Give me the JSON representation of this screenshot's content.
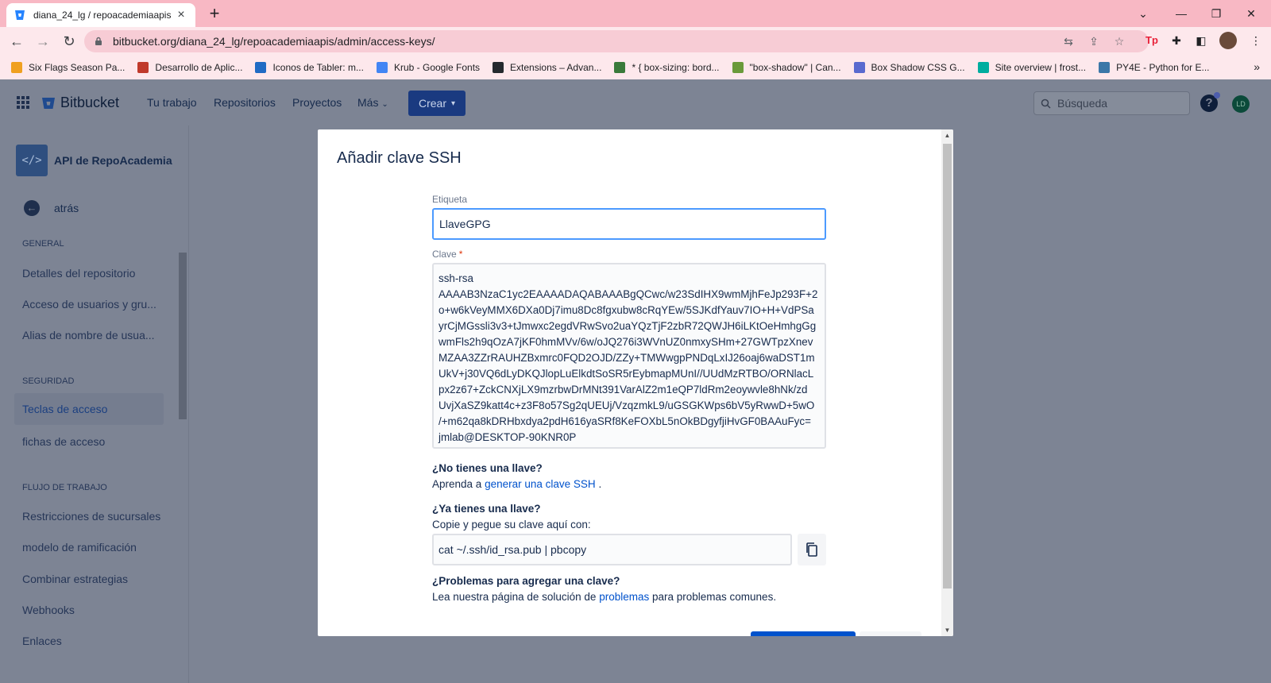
{
  "browser": {
    "tab_title": "diana_24_lg / repoacademiaapis",
    "url": "bitbucket.org/diana_24_lg/repoacademiaapis/admin/access-keys/",
    "bookmarks": [
      {
        "label": "Six Flags Season Pa...",
        "color": "#f0a020"
      },
      {
        "label": "Desarrollo de Aplic...",
        "color": "#c0392b"
      },
      {
        "label": "Iconos de Tabler: m...",
        "color": "#206bc4"
      },
      {
        "label": "Krub - Google Fonts",
        "color": "#4285f4"
      },
      {
        "label": "Extensions – Advan...",
        "color": "#24292e"
      },
      {
        "label": "* { box-sizing: bord...",
        "color": "#3a7a3a"
      },
      {
        "label": "\"box-shadow\" | Can...",
        "color": "#6a9a3a"
      },
      {
        "label": "Box Shadow CSS G...",
        "color": "#5a6acf"
      },
      {
        "label": "Site overview | frost...",
        "color": "#00ad9f"
      },
      {
        "label": "PY4E - Python for E...",
        "color": "#3b77a8"
      }
    ]
  },
  "header": {
    "product": "Bitbucket",
    "nav": [
      "Tu trabajo",
      "Repositorios",
      "Proyectos",
      "Más"
    ],
    "create": "Crear",
    "search_placeholder": "Búsqueda",
    "help": "?",
    "avatar": "LD"
  },
  "sidebar": {
    "repo_name": "API de RepoAcademia",
    "back": "atrás",
    "sections": {
      "general": "GENERAL",
      "security": "SEGURIDAD",
      "workflow": "FLUJO DE TRABAJO"
    },
    "general_items": [
      "Detalles del repositorio",
      "Acceso de usuarios y gru...",
      "Alias de nombre de usua..."
    ],
    "security_items": [
      "Teclas de acceso",
      "fichas de acceso"
    ],
    "workflow_items": [
      "Restricciones de sucursales",
      "modelo de ramificación",
      "Combinar estrategias",
      "Webhooks",
      "Enlaces"
    ]
  },
  "modal": {
    "title": "Añadir clave SSH",
    "label_field": "Etiqueta",
    "label_value": "LlaveGPG",
    "key_field": "Clave",
    "required_mark": "*",
    "key_lines": [
      "ssh-rsa",
      "AAAAB3NzaC1yc2EAAAADAQABAAABgQCwc/w23SdIHX9wmMjhFeJp293F+2",
      "o+w6kVeyMMX6DXa0Dj7imu8Dc8fgxubw8cRqYEw/5SJKdfYauv7IO+H+VdPSa",
      "yrCjMGssli3v3+tJmwxc2egdVRwSvo2uaYQzTjF2zbR72QWJH6iLKtOeHmhgGg",
      "wmFls2h9qOzA7jKF0hmMVv/6w/oJQ276i3WVnUZ0nmxySHm+27GWTpzXnev",
      "MZAA3ZZrRAUHZBxmrc0FQD2OJD/ZZy+TMWwgpPNDqLxIJ26oaj6waDST1m",
      "UkV+j30VQ6dLyDKQJlopLuElkdtSoSR5rEybmapMUnI//UUdMzRTBO/ORNlacL",
      "px2z67+ZckCNXjLX9mzrbwDrMNt391VarAlZ2m1eQP7ldRm2eoywvle8hNk/zd",
      "UvjXaSZ9katt4c+z3F8o57Sg2qUEUj/VzqzmkL9/uGSGKWps6bV5yRwwD+5wO",
      "/+m62qa8kDRHbxdya2pdH616yaSRf8KeFOXbL5nOkBDgyfjiHvGF0BAAuFyc=",
      "jmlab@DESKTOP-90KNR0P"
    ],
    "no_key_title": "¿No tienes una llave?",
    "no_key_text": "Aprenda a",
    "no_key_link": "generar una clave SSH",
    "no_key_end": ".",
    "have_key_title": "¿Ya tienes una llave?",
    "have_key_text": "Copie y pegue su clave aquí con:",
    "command": "cat ~/.ssh/id_rsa.pub | pbcopy",
    "problems_title": "¿Problemas para agregar una clave?",
    "problems_text": "Lea nuestra página de solución de",
    "problems_link": "problemas",
    "problems_end": "para problemas comunes."
  },
  "colors": {
    "tabstrip": "#f8b8c4",
    "toolbar": "#fde8ec",
    "overlay": "#7d8494",
    "primary": "#0052cc",
    "link": "#0052cc"
  }
}
